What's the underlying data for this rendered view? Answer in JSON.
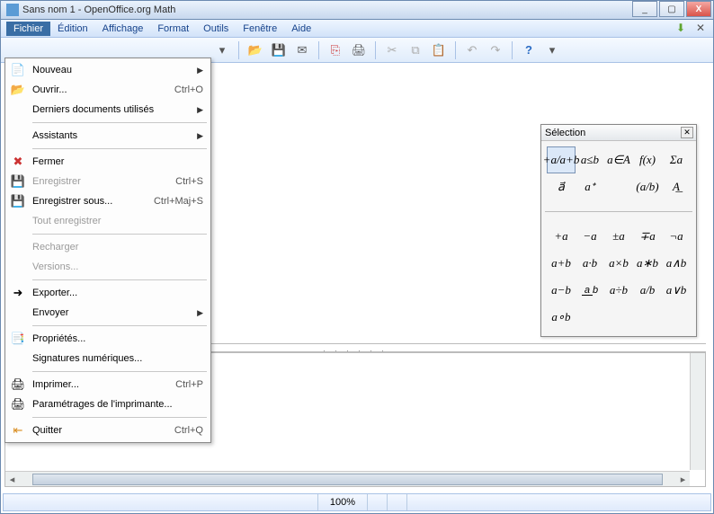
{
  "window": {
    "title": "Sans nom 1 - OpenOffice.org Math",
    "buttons": {
      "min": "_",
      "max": "▢",
      "close": "X"
    }
  },
  "menubar": {
    "items": [
      "Fichier",
      "Édition",
      "Affichage",
      "Format",
      "Outils",
      "Fenêtre",
      "Aide"
    ],
    "activeIndex": 0
  },
  "filemenu": {
    "nouveau": "Nouveau",
    "ouvrir": "Ouvrir...",
    "ouvrir_sc": "Ctrl+O",
    "recents": "Derniers documents utilisés",
    "assistants": "Assistants",
    "fermer": "Fermer",
    "enregistrer": "Enregistrer",
    "enregistrer_sc": "Ctrl+S",
    "enregistrer_sous": "Enregistrer sous...",
    "enregistrer_sous_sc": "Ctrl+Maj+S",
    "tout_enreg": "Tout enregistrer",
    "recharger": "Recharger",
    "versions": "Versions...",
    "exporter": "Exporter...",
    "envoyer": "Envoyer",
    "proprietes": "Propriétés...",
    "signatures": "Signatures numériques...",
    "imprimer": "Imprimer...",
    "imprimer_sc": "Ctrl+P",
    "param_impr": "Paramétrages de l'imprimante...",
    "quitter": "Quitter",
    "quitter_sc": "Ctrl+Q"
  },
  "selection": {
    "title": "Sélection",
    "top": {
      "r0": [
        "+a/a+b",
        "a≤b",
        "a∈A",
        "f(x)",
        "Σa"
      ],
      "r1": [
        "a⃗",
        "aᐩ",
        "",
        "(a/b)",
        "A͟"
      ]
    },
    "bottom": {
      "r0": [
        "+a",
        "−a",
        "±a",
        "∓a",
        "¬a"
      ],
      "r1": [
        "a+b",
        "a∙b",
        "a×b",
        "a∗b",
        "a∧b"
      ],
      "r2": [
        "a−b",
        "a/b",
        "a÷b",
        "a/b",
        "a∨b"
      ],
      "r3": [
        "a∘b",
        "",
        "",
        "",
        ""
      ]
    },
    "bottom_display": {
      "r2_1": "a⁄b"
    }
  },
  "status": {
    "zoom": "100%"
  },
  "splitter": ". . . . . ."
}
